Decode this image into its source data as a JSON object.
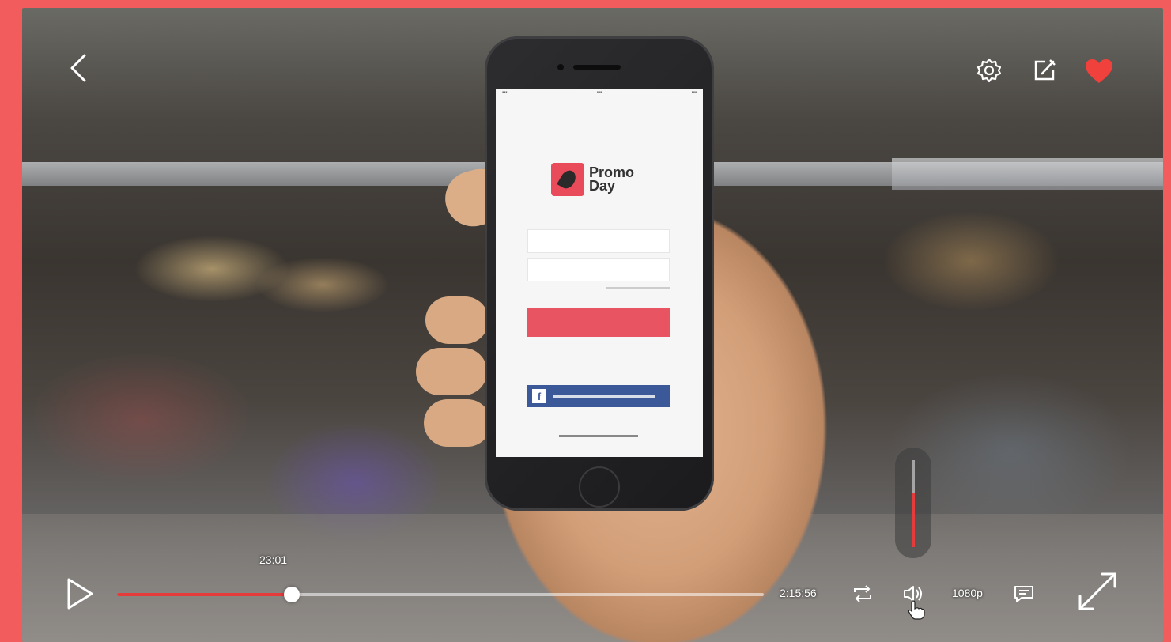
{
  "player": {
    "hover_time": "23:01",
    "duration": "2:15:56",
    "quality": "1080p",
    "progress": 0.27,
    "volume": 0.62,
    "accent_color": "#e53b3b",
    "frame_color": "#f25c5c"
  },
  "icons": {
    "back": "chevron-left-icon",
    "settings": "gear-icon",
    "edit": "edit-icon",
    "favorite": "heart-icon",
    "play": "play-icon",
    "loop": "loop-icon",
    "volume": "volume-icon",
    "captions": "captions-icon",
    "fullscreen": "fullscreen-icon"
  },
  "phone_app": {
    "logo_line1": "Promo",
    "logo_line2": "Day"
  }
}
